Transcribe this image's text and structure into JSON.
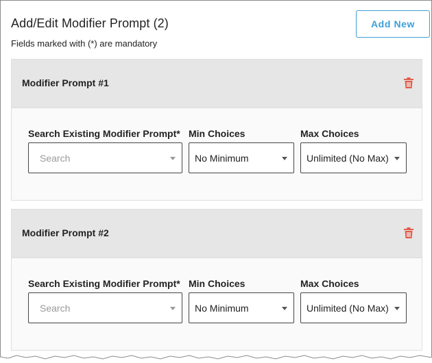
{
  "header": {
    "title": "Add/Edit Modifier Prompt (2)",
    "subtitle": "Fields marked with (*) are mandatory",
    "add_new_label": "Add New"
  },
  "colors": {
    "accent": "#3d9ed6",
    "delete": "#e25c4a",
    "card_header_bg": "#e6e6e6"
  },
  "prompts": [
    {
      "title": "Modifier Prompt #1",
      "search_label": "Search Existing Modifier Prompt*",
      "search_placeholder": "Search",
      "min_label": "Min Choices",
      "min_value": "No Minimum",
      "max_label": "Max Choices",
      "max_value": "Unlimited (No Max)"
    },
    {
      "title": "Modifier Prompt #2",
      "search_label": "Search Existing Modifier Prompt*",
      "search_placeholder": "Search",
      "min_label": "Min Choices",
      "min_value": "No Minimum",
      "max_label": "Max Choices",
      "max_value": "Unlimited (No Max)"
    }
  ]
}
